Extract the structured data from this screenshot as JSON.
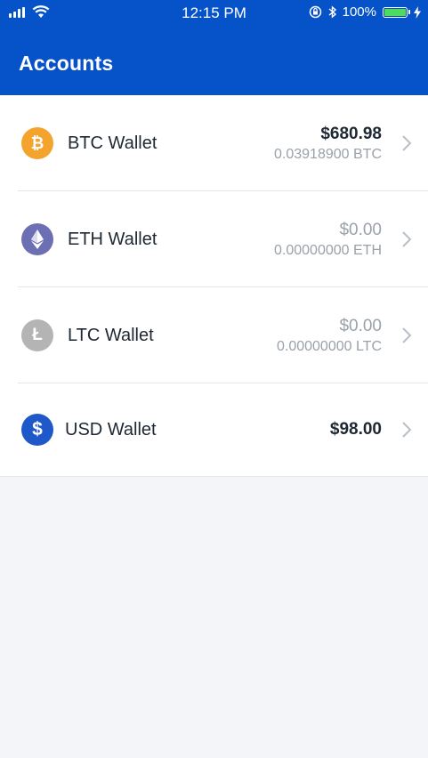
{
  "status_bar": {
    "time": "12:15 PM",
    "battery": "100%",
    "battery_level": 1.0,
    "icons": [
      "signal-icon",
      "wifi-icon",
      "orientation-lock-icon",
      "bluetooth-icon",
      "battery-icon",
      "charging-icon"
    ]
  },
  "header": {
    "title": "Accounts",
    "background": "#0652c8"
  },
  "wallets": [
    {
      "name": "BTC Wallet",
      "fiat": "$680.98",
      "crypto": "0.03918900 BTC",
      "icon": "bitcoin-icon",
      "color": "#f4a32d",
      "glyph": "₿"
    },
    {
      "name": "ETH Wallet",
      "fiat": "$0.00",
      "crypto": "0.00000000 ETH",
      "icon": "ethereum-icon",
      "color": "#6c6fb3",
      "glyph": ""
    },
    {
      "name": "LTC Wallet",
      "fiat": "$0.00",
      "crypto": "0.00000000 LTC",
      "icon": "litecoin-icon",
      "color": "#b4b4b4",
      "glyph": "Ł"
    },
    {
      "name": "USD Wallet",
      "fiat": "$98.00",
      "crypto": "",
      "icon": "dollar-icon",
      "color": "#1f58c9",
      "glyph": "$"
    }
  ]
}
